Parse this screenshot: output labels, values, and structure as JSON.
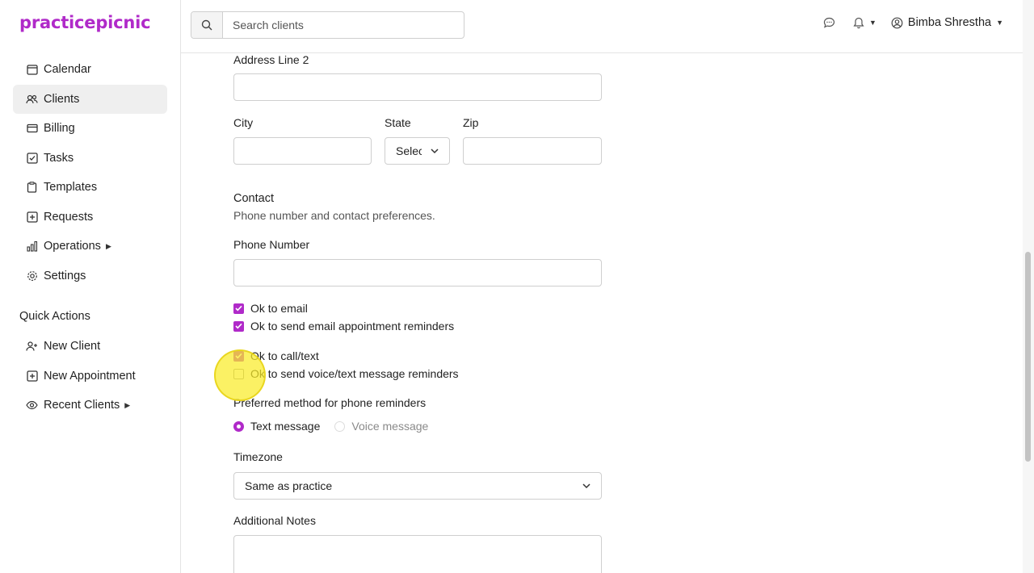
{
  "brand": {
    "logo": "practicepicnic",
    "color": "#b02ac9"
  },
  "sidebar": {
    "items": [
      {
        "label": "Calendar",
        "icon": "calendar-icon"
      },
      {
        "label": "Clients",
        "icon": "users-icon",
        "active": true
      },
      {
        "label": "Billing",
        "icon": "credit-card-icon"
      },
      {
        "label": "Tasks",
        "icon": "checkbox-icon"
      },
      {
        "label": "Templates",
        "icon": "clipboard-icon"
      },
      {
        "label": "Requests",
        "icon": "inbox-plus-icon"
      },
      {
        "label": "Operations",
        "icon": "bar-chart-icon",
        "has_submenu": true
      },
      {
        "label": "Settings",
        "icon": "gear-icon"
      }
    ],
    "quick_actions_title": "Quick Actions",
    "quick_actions": [
      {
        "label": "New Client",
        "icon": "user-plus-icon"
      },
      {
        "label": "New Appointment",
        "icon": "calendar-plus-icon"
      },
      {
        "label": "Recent Clients",
        "icon": "eye-icon",
        "has_submenu": true
      }
    ]
  },
  "topbar": {
    "search_placeholder": "Search clients",
    "user_name": "Bimba Shrestha"
  },
  "form": {
    "address2_label": "Address Line 2",
    "city_label": "City",
    "state_label": "State",
    "state_value": "Select",
    "zip_label": "Zip",
    "contact_title": "Contact",
    "contact_subtitle": "Phone number and contact preferences.",
    "phone_label": "Phone Number",
    "checkboxes": [
      {
        "label": "Ok to email",
        "checked": true
      },
      {
        "label": "Ok to send email appointment reminders",
        "checked": true
      },
      {
        "label": "Ok to call/text",
        "checked": true
      },
      {
        "label": "Ok to send voice/text message reminders",
        "checked": false
      }
    ],
    "phone_reminder_label": "Preferred method for phone reminders",
    "radio_options": [
      {
        "label": "Text message",
        "selected": true
      },
      {
        "label": "Voice message",
        "selected": false
      }
    ],
    "timezone_label": "Timezone",
    "timezone_value": "Same as practice",
    "notes_label": "Additional Notes"
  }
}
